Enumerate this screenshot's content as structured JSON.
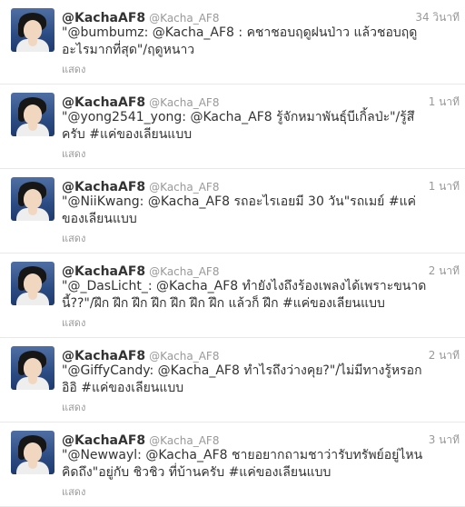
{
  "tweets": [
    {
      "name": "@KachaAF8",
      "handle": "@Kacha_AF8",
      "time": "34 วินาที",
      "text": "\"@bumbumz: @Kacha_AF8 : คชาชอบฤดูฝนป่าว แล้วชอบฤดูอะไรมากที่สุด\"/ฤดูหนาว",
      "show": "แสดง"
    },
    {
      "name": "@KachaAF8",
      "handle": "@Kacha_AF8",
      "time": "1 นาที",
      "text": "\"@yong2541_yong: @Kacha_AF8 รู้จักหมาพันธุ์บีเกิ้ลป่ะ\"/รู้สึครับ #แค่ของเลียนแบบ",
      "show": "แสดง"
    },
    {
      "name": "@KachaAF8",
      "handle": "@Kacha_AF8",
      "time": "1 นาที",
      "text": "\"@NiiKwang: @Kacha_AF8 รถอะไรเอยมี 30 วัน\"รถเมย์ #แค่ของเลียนแบบ",
      "show": "แสดง"
    },
    {
      "name": "@KachaAF8",
      "handle": "@Kacha_AF8",
      "time": "2 นาที",
      "text": "\"@_DasLicht_: @Kacha_AF8 ทำยังไงถึงร้องเพลงได้เพราะขนาดนี้??\"/ฝึก ฝึก ฝึก ฝึก ฝึก ฝึก ฝึก แล้วก็ ฝึก #แค่ของเลียนแบบ",
      "show": "แสดง"
    },
    {
      "name": "@KachaAF8",
      "handle": "@Kacha_AF8",
      "time": "2 นาที",
      "text": "\"@GiffyCandy: @Kacha_AF8 ทำไรถึงว่างคุย?\"/ไม่มีทางรู้หรอก อิอิ #แค่ของเลียนแบบ",
      "show": "แสดง"
    },
    {
      "name": "@KachaAF8",
      "handle": "@Kacha_AF8",
      "time": "3 นาที",
      "text": "\"@Newwayl: @Kacha_AF8 ชายอยากถามชาว่ารับทรัพย์อยู่ไหนคิดถึง\"อยู่กับ ชิวชิว ที่บ้านครับ #แค่ของเลียนแบบ",
      "show": "แสดง"
    }
  ]
}
